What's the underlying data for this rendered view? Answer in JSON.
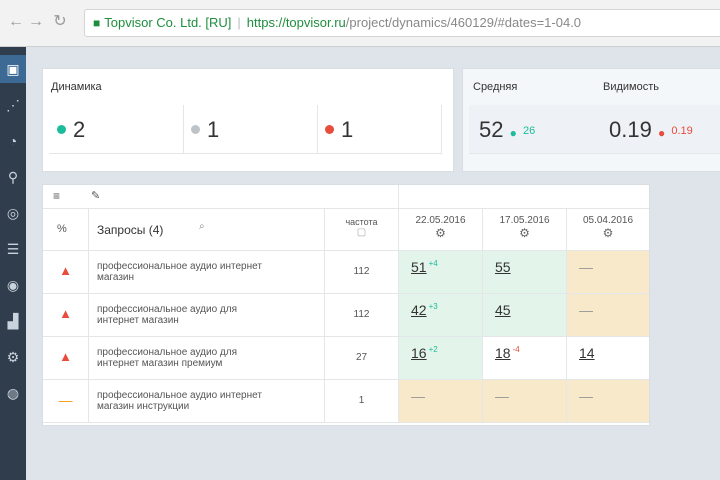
{
  "browser": {
    "nav_back": "←",
    "nav_forward": "→",
    "nav_reload": "↻",
    "secure_label": "Topvisor Co. Ltd. [RU]",
    "url_host": "https://topvisor.ru",
    "url_path": "/project/dynamics/460129/#dates=1-04.0"
  },
  "sidebar": {
    "items": [
      {
        "icon": "dashboard-icon",
        "glyph": "▣"
      },
      {
        "icon": "share-icon",
        "glyph": "⋰"
      },
      {
        "icon": "pie-icon",
        "glyph": "◔"
      },
      {
        "icon": "search-icon",
        "glyph": "⚲"
      },
      {
        "icon": "target-icon",
        "glyph": "◎"
      },
      {
        "icon": "list-icon",
        "glyph": "☰"
      },
      {
        "icon": "eye-icon",
        "glyph": "◉"
      },
      {
        "icon": "chart-icon",
        "glyph": "▟"
      },
      {
        "icon": "settings-icon",
        "glyph": "⚙"
      },
      {
        "icon": "more-icon",
        "glyph": "◍"
      }
    ]
  },
  "summary": {
    "dynamics_title": "Динамика",
    "up": "2",
    "same": "1",
    "down": "1",
    "avg_title": "Средняя",
    "avg_value": "52",
    "avg_delta": "26",
    "visibility_title": "Видимость",
    "visibility_value": "0.19",
    "visibility_delta": "0.19"
  },
  "colors": {
    "up": "#1abc9c",
    "same": "#bdc3c7",
    "down": "#e74c3c",
    "green_cell": "#e3f5ea",
    "orange_cell": "#f7e9c9"
  },
  "table": {
    "toolbar_left": "≡",
    "toolbar_right": "✎",
    "col_check": "%",
    "col_query": "Запросы (4)",
    "col_freq": "частота",
    "dates": [
      "22.05.2016",
      "17.05.2016",
      "05.04.2016"
    ],
    "rows": [
      {
        "status": "▲",
        "query": "профессиональное аудио интернет магазин",
        "freq": "112",
        "v1": "51",
        "d1": "+4",
        "v2": "55",
        "d2": "",
        "v3": "—"
      },
      {
        "status": "▲",
        "query": "профессиональное аудио для интернет магазин",
        "freq": "112",
        "v1": "42",
        "d1": "+3",
        "v2": "45",
        "d2": "",
        "v3": "—"
      },
      {
        "status": "▲",
        "query": "профессиональное аудио для интернет магазин премиум",
        "freq": "27",
        "v1": "16",
        "d1": "+2",
        "v2": "18",
        "d2": "-4",
        "v3": "14"
      },
      {
        "status": "—",
        "query": "профессиональное аудио интернет магазин инструкции",
        "freq": "1",
        "v1": "—",
        "d1": "",
        "v2": "—",
        "d2": "",
        "v3": "—"
      }
    ]
  }
}
